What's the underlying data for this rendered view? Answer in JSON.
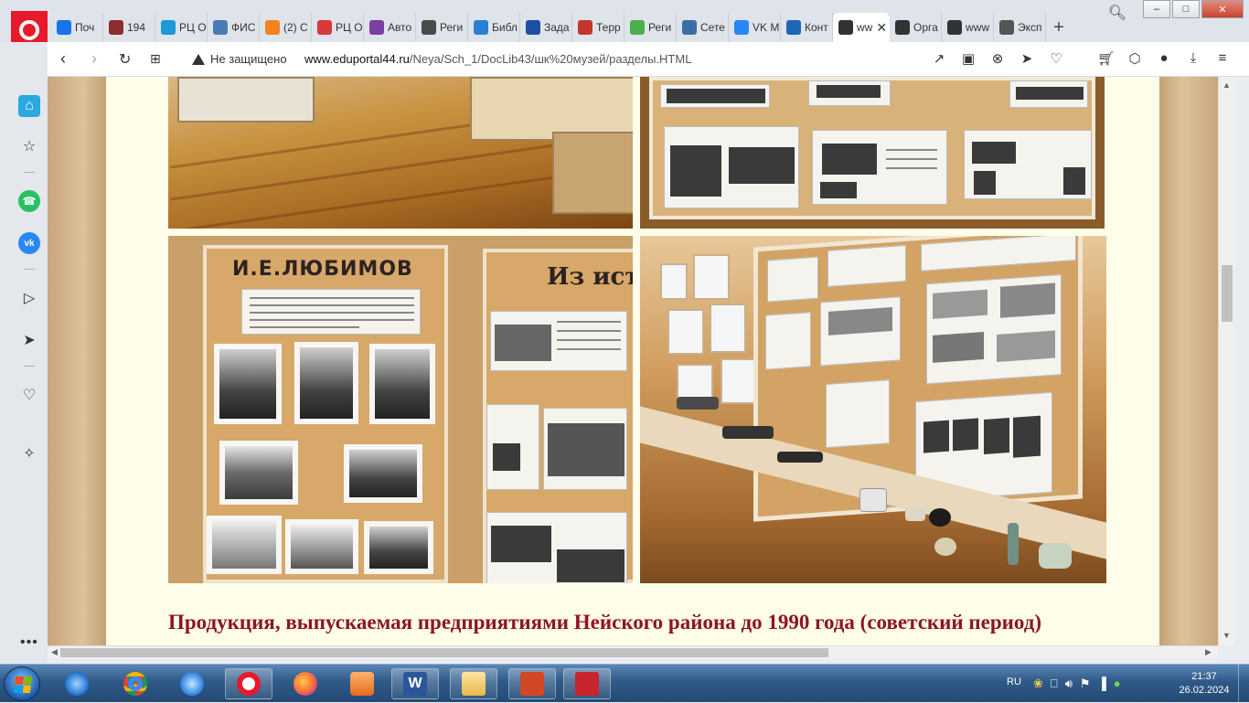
{
  "browser": {
    "tabs": [
      {
        "label": "Поч",
        "icon": "mail-icon",
        "color": "#1a73e8"
      },
      {
        "label": "194",
        "icon": "museum-icon",
        "color": "#8b2e2e"
      },
      {
        "label": "РЦ О",
        "icon": "oko-icon",
        "color": "#1c9ad6"
      },
      {
        "label": "ФИС",
        "icon": "fis-icon",
        "color": "#4b7bb5"
      },
      {
        "label": "(2) С",
        "icon": "ok-icon",
        "color": "#f58220"
      },
      {
        "label": "РЦ О",
        "icon": "chart-icon",
        "color": "#d63a3a"
      },
      {
        "label": "Авто",
        "icon": "grid-icon",
        "color": "#7b3fa0"
      },
      {
        "label": "Реги",
        "icon": "table-icon",
        "color": "#4a4a4a"
      },
      {
        "label": "Библ",
        "icon": "book-icon",
        "color": "#2a7fcf"
      },
      {
        "label": "Зада",
        "icon": "flag-icon",
        "color": "#1e4fa3"
      },
      {
        "label": "Терр",
        "icon": "flag-icon",
        "color": "#c0392b"
      },
      {
        "label": "Реги",
        "icon": "puzzle-icon",
        "color": "#4cae4c"
      },
      {
        "label": "Сете",
        "icon": "doc-icon",
        "color": "#3b6ea5"
      },
      {
        "label": "VK М",
        "icon": "vk-icon",
        "color": "#2787f5"
      },
      {
        "label": "Конт",
        "icon": "s-icon",
        "color": "#1e66b7"
      },
      {
        "label": "ww",
        "icon": "globe-icon",
        "color": "#333333",
        "active": true
      },
      {
        "label": "Орга",
        "icon": "globe-icon",
        "color": "#333333"
      },
      {
        "label": "www",
        "icon": "globe-icon",
        "color": "#333333"
      },
      {
        "label": "Эксп",
        "icon": "apps-icon",
        "color": "#555555"
      }
    ],
    "address": {
      "security": "Не защищено",
      "host": "www.eduportal44.ru",
      "path": "/Neya/Sch_1/DocLib43/шк%20музей/разделы.HTML"
    }
  },
  "page": {
    "heading": "Продукция, выпускаемая предприятиями Нейского района до 1990 года (советский период)",
    "photo3_title": "И.Е.ЛЮБИМОВ",
    "photo3_title2": "Из исто"
  },
  "taskbar": {
    "lang": "RU",
    "time": "21:37",
    "date": "26.02.2024"
  }
}
